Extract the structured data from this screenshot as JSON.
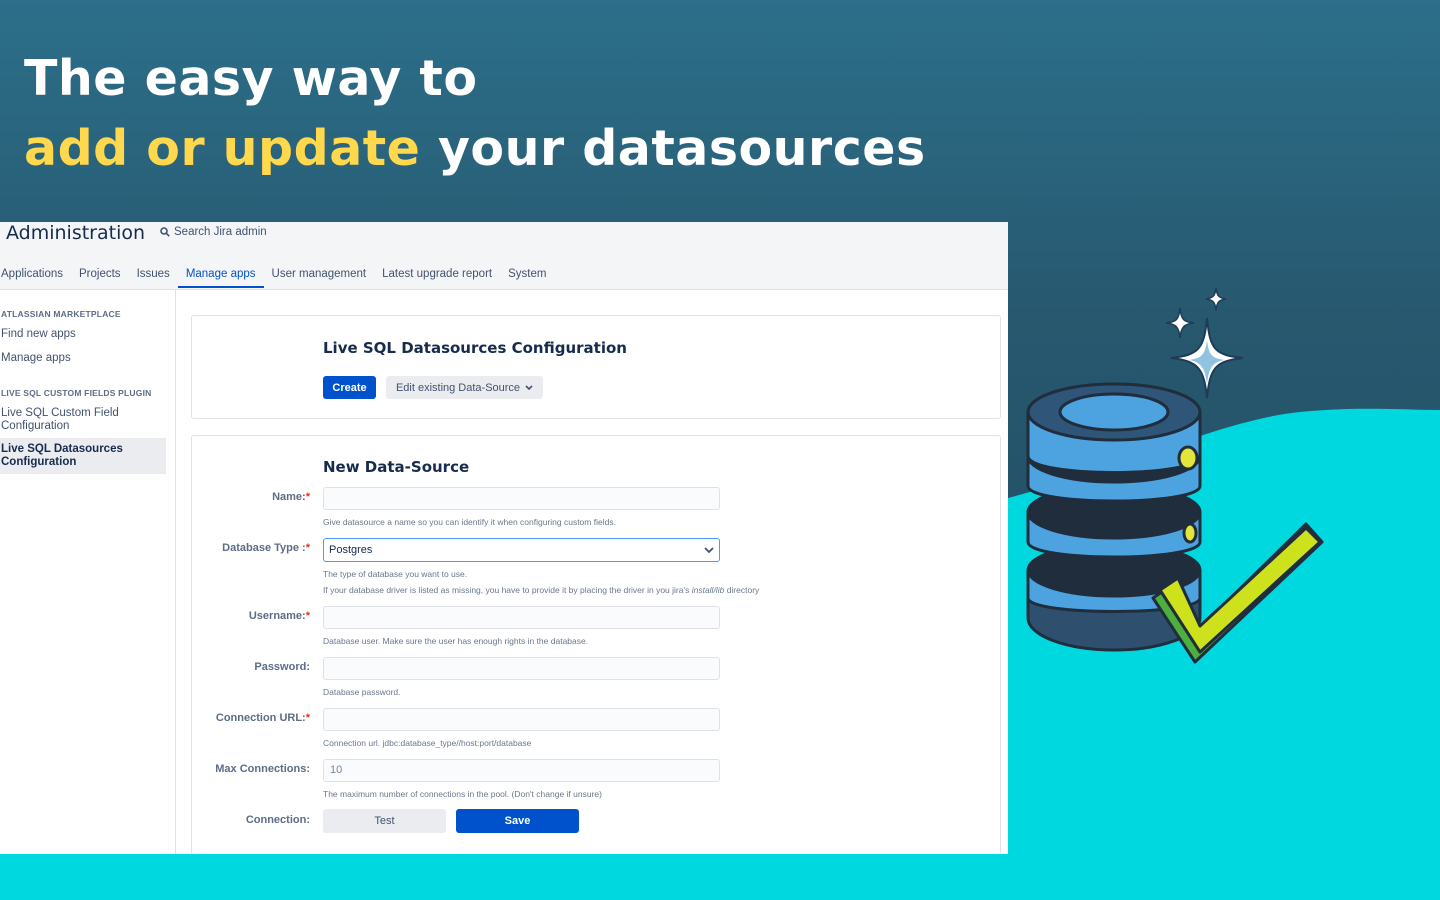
{
  "headline": {
    "line1": "The easy way to",
    "accent": "add or update",
    "rest": " your datasources"
  },
  "admin": {
    "title": "Administration",
    "search_placeholder": "Search Jira admin"
  },
  "tabs": [
    {
      "label": "Applications",
      "active": false
    },
    {
      "label": "Projects",
      "active": false
    },
    {
      "label": "Issues",
      "active": false
    },
    {
      "label": "Manage apps",
      "active": true
    },
    {
      "label": "User management",
      "active": false
    },
    {
      "label": "Latest upgrade report",
      "active": false
    },
    {
      "label": "System",
      "active": false
    }
  ],
  "sidebar": {
    "section1_heading": "ATLASSIAN MARKETPLACE",
    "find_new_apps": "Find new apps",
    "manage_apps": "Manage apps",
    "section2_heading": "LIVE SQL CUSTOM FIELDS PLUGIN",
    "custom_field_config": "Live SQL Custom Field Configuration",
    "datasources_config": "Live SQL Datasources Configuration"
  },
  "config_card": {
    "title": "Live SQL Datasources Configuration",
    "create_label": "Create",
    "edit_label": "Edit existing Data-Source"
  },
  "form": {
    "title": "New Data-Source",
    "name_label": "Name:",
    "name_help": "Give datasource a name so you can identify it when configuring custom fields.",
    "dbtype_label": "Database Type :",
    "dbtype_value": "Postgres",
    "dbtype_help1": "The type of database you want to use.",
    "dbtype_help2_pre": "If your database driver is listed as missing, you have to provide it by placing the driver in you jira's ",
    "dbtype_help2_path": "install/lib",
    "dbtype_help2_post": " directory",
    "username_label": "Username:",
    "username_help": "Database user. Make sure the user has enough rights in the database.",
    "password_label": "Password:",
    "password_help": "Database password.",
    "url_label": "Connection URL:",
    "url_help": "Connection url. jdbc:database_type//host:port/database",
    "maxconn_label": "Max Connections:",
    "maxconn_value": "10",
    "maxconn_help": "The maximum number of connections in the pool. (Don't change if unsure)",
    "connection_label": "Connection:",
    "test_label": "Test",
    "save_label": "Save",
    "required_mark": "*"
  },
  "colors": {
    "accent_yellow": "#ffd84d",
    "brand_blue": "#0052cc",
    "cyan": "#00d8e0",
    "bg_teal": "#27586f"
  },
  "icons": [
    "search-icon",
    "chevron-down-icon",
    "database-icon",
    "checkmark-icon",
    "sparkle-icon"
  ]
}
